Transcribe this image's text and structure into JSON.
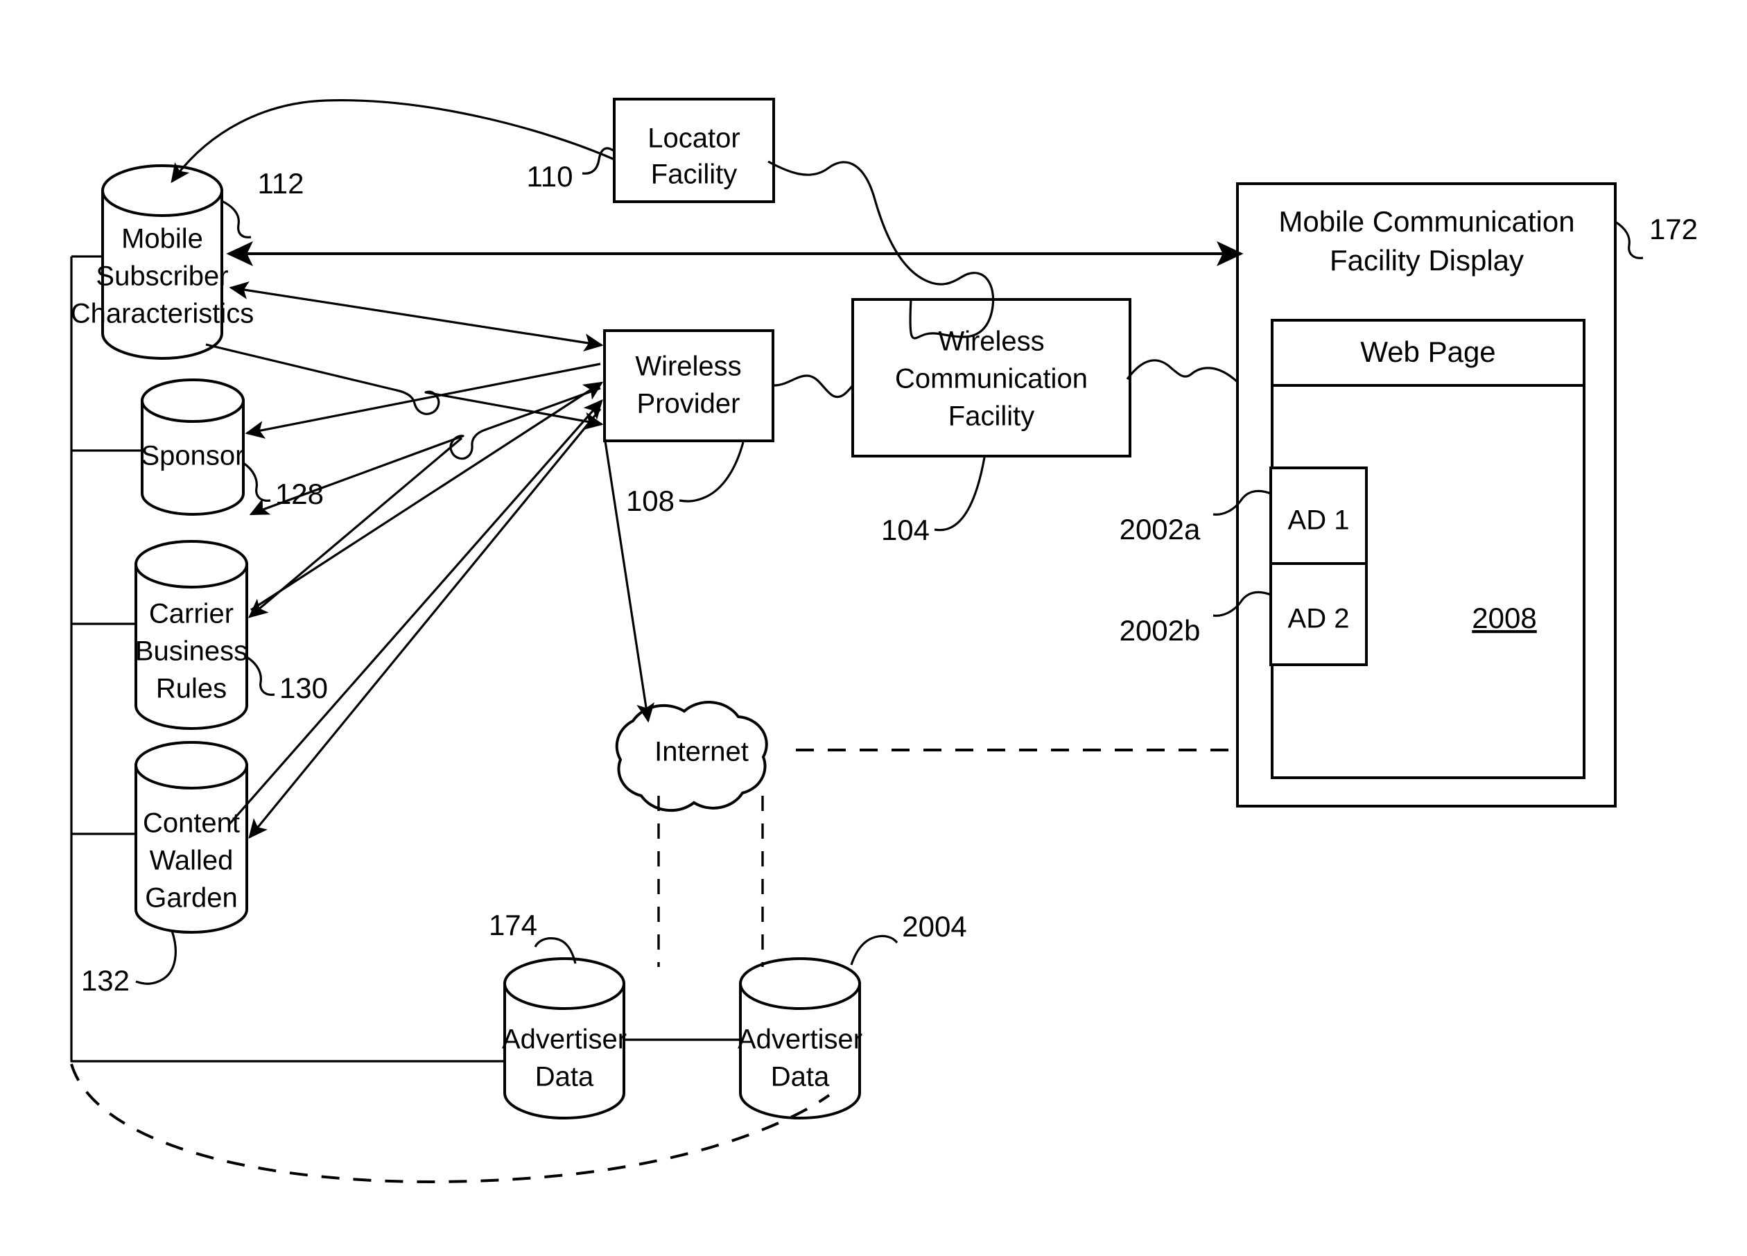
{
  "figure": {
    "type": "patent-block-diagram",
    "background": "#ffffff",
    "line_color": "#000000"
  },
  "nodes": {
    "mobile_subscriber_characteristics": {
      "label_line1": "Mobile",
      "label_line2": "Subscriber",
      "label_line3": "Characteristics",
      "shape": "cylinder",
      "ref": "112"
    },
    "locator_facility": {
      "label_line1": "Locator",
      "label_line2": "Facility",
      "shape": "rectangle",
      "ref": "110"
    },
    "sponsor": {
      "label_line1": "Sponsor",
      "shape": "cylinder",
      "ref": "128"
    },
    "carrier_business_rules": {
      "label_line1": "Carrier",
      "label_line2": "Business",
      "label_line3": "Rules",
      "shape": "cylinder",
      "ref": "130"
    },
    "content_walled_garden": {
      "label_line1": "Content",
      "label_line2": "Walled",
      "label_line3": "Garden",
      "shape": "cylinder",
      "ref": "132"
    },
    "wireless_provider": {
      "label_line1": "Wireless",
      "label_line2": "Provider",
      "shape": "rectangle",
      "ref": "108"
    },
    "wireless_communication_facility": {
      "label_line1": "Wireless",
      "label_line2": "Communication",
      "label_line3": "Facility",
      "shape": "rectangle",
      "ref": "104"
    },
    "internet": {
      "label_line1": "Internet",
      "shape": "cloud"
    },
    "advertiser_data_left": {
      "label_line1": "Advertiser",
      "label_line2": "Data",
      "shape": "cylinder",
      "ref": "174"
    },
    "advertiser_data_right": {
      "label_line1": "Advertiser",
      "label_line2": "Data",
      "shape": "cylinder",
      "ref": "2004"
    },
    "mobile_communication_facility_display": {
      "label_line1": "Mobile Communication",
      "label_line2": "Facility Display",
      "shape": "rectangle",
      "ref": "172"
    },
    "web_page": {
      "label_line1": "Web Page",
      "shape": "rectangle"
    },
    "ad_1": {
      "label_line1": "AD 1",
      "shape": "rectangle",
      "ref": "2002a"
    },
    "ad_2": {
      "label_line1": "AD 2",
      "shape": "rectangle",
      "ref": "2002b"
    },
    "web_page_content": {
      "label_line1": "2008",
      "underlined": true
    }
  },
  "reference_numerals": {
    "msc": "112",
    "locator_facility": "110",
    "sponsor": "128",
    "carrier_business_rules": "130",
    "content_walled_garden": "132",
    "wireless_provider": "108",
    "wireless_communication_facility": "104",
    "advertiser_data_left": "174",
    "advertiser_data_right": "2004",
    "display": "172",
    "ad1": "2002a",
    "ad2": "2002b",
    "web_content": "2008"
  }
}
